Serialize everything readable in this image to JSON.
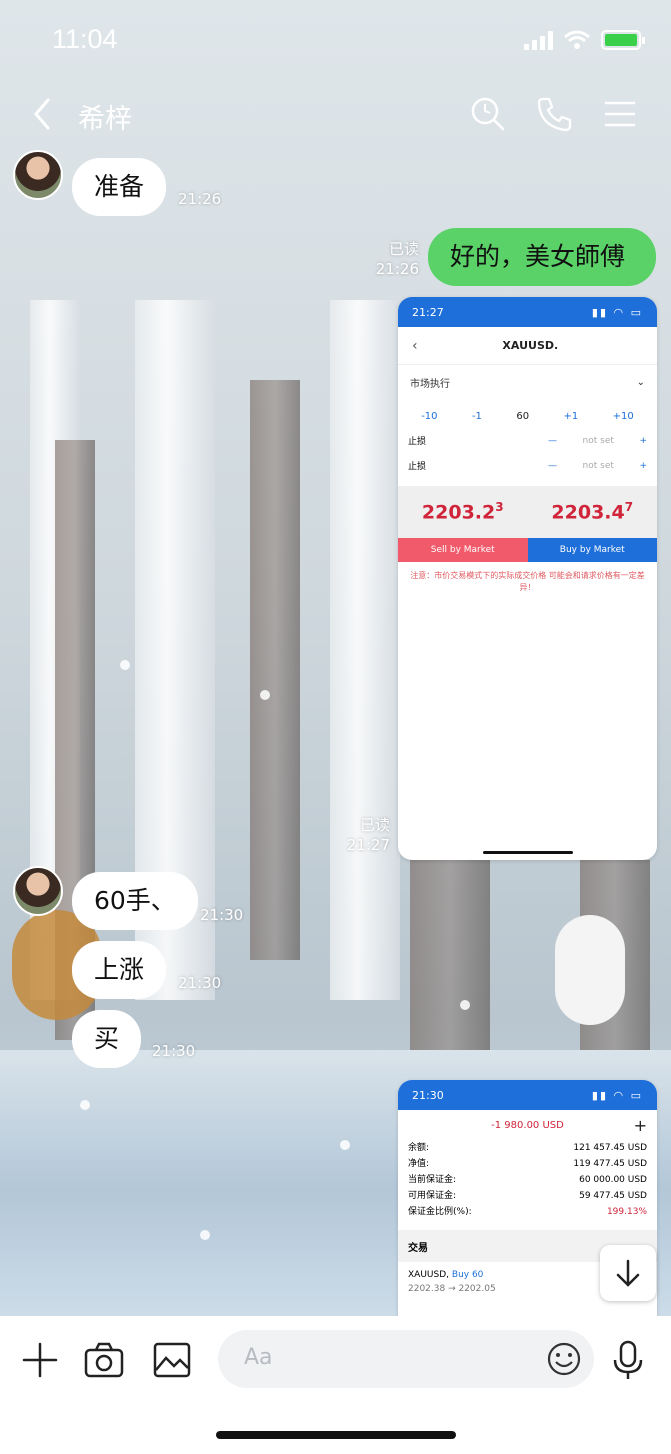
{
  "status_bar": {
    "time": "11:04"
  },
  "header": {
    "back_icon": "chevron-left-icon",
    "contact_name": "希梓",
    "icons": [
      "search-icon",
      "phone-icon",
      "menu-icon"
    ]
  },
  "messages": [
    {
      "side": "left",
      "text": "准备",
      "time": "21:26"
    },
    {
      "side": "right",
      "text": "好的，美女師傅",
      "read": "已读",
      "time": "21:26"
    },
    {
      "side": "right",
      "type": "image",
      "read": "已读",
      "time": "21:27"
    },
    {
      "side": "left",
      "text": "60手、",
      "time": "21:30"
    },
    {
      "side": "left",
      "text": "上涨",
      "time": "21:30"
    },
    {
      "side": "left",
      "text": "买",
      "time": "21:30"
    }
  ],
  "trade_screenshot": {
    "time": "21:27",
    "symbol": "XAUUSD.",
    "mode": "市场执行",
    "steps": [
      "-10",
      "-1",
      "60",
      "+1",
      "+10"
    ],
    "stop_loss_label": "止损",
    "take_profit_label": "止损",
    "not_set": "not set",
    "sell_price_main": "2203.2",
    "sell_price_sup": "3",
    "buy_price_main": "2203.4",
    "buy_price_sup": "7",
    "sell_button": "Sell by Market",
    "buy_button": "Buy by Market",
    "note": "注意：市价交易模式下的实际成交价格    可能会和请求价格有一定差异！"
  },
  "account_screenshot": {
    "time": "21:30",
    "profit": "-1 980.00 USD",
    "rows": [
      {
        "label": "余额:",
        "value": "121 457.45 USD"
      },
      {
        "label": "净值:",
        "value": "119 477.45 USD"
      },
      {
        "label": "当前保证金:",
        "value": "60 000.00 USD"
      },
      {
        "label": "可用保证金:",
        "value": "59 477.45 USD"
      },
      {
        "label": "保证金比例(%):",
        "value": "199.13%"
      }
    ],
    "section": "交易",
    "position_symbol": "XAUUSD,",
    "position_side": "Buy 60",
    "position_prices": "2202.38 → 2202.05"
  },
  "input_bar": {
    "placeholder": "Aa",
    "icons": [
      "plus-icon",
      "camera-icon",
      "image-icon",
      "emoji-icon",
      "microphone-icon"
    ]
  },
  "colors": {
    "sent_bubble": "#5ad267",
    "blue": "#1e6fd9",
    "sell_red": "#f05a6a",
    "price_red": "#d0243a"
  }
}
